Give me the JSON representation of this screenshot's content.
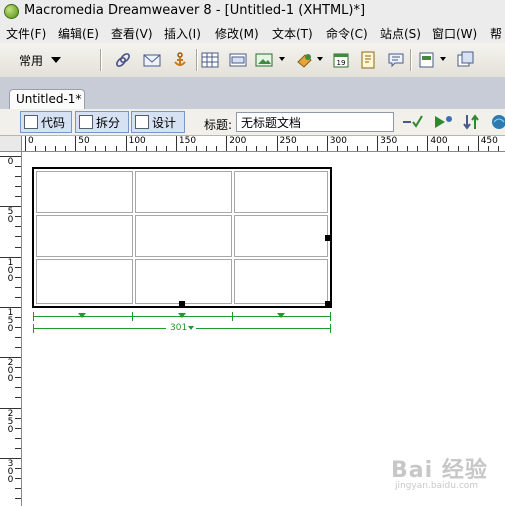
{
  "window": {
    "title": "Macromedia Dreamweaver 8 - [Untitled-1 (XHTML)*]"
  },
  "menu": [
    "文件(F)",
    "编辑(E)",
    "查看(V)",
    "插入(I)",
    "修改(M)",
    "文本(T)",
    "命令(C)",
    "站点(S)",
    "窗口(W)",
    "帮"
  ],
  "toolbar": {
    "category": "常用",
    "icons": [
      "hyperlink-icon",
      "email-link-icon",
      "named-anchor-icon",
      "table-icon",
      "div-icon",
      "image-icon",
      "media-icon",
      "date-icon",
      "comment-icon",
      "script-icon",
      "tag-chooser-icon",
      "templates-icon"
    ]
  },
  "document": {
    "tab_label": "Untitled-1*",
    "view_buttons": {
      "code": "代码",
      "split": "拆分",
      "design": "设计"
    },
    "title_label": "标题:",
    "title_value": "无标题文档"
  },
  "ruler": {
    "top_labels": [
      "0",
      "50",
      "100",
      "150",
      "200",
      "250",
      "300",
      "350",
      "400",
      "450"
    ],
    "left_labels": [
      "0",
      "50",
      "100",
      "150",
      "200",
      "250",
      "300"
    ]
  },
  "table": {
    "rows": 3,
    "columns": 3,
    "width_label": "301"
  },
  "watermark": {
    "text": "Bai 经验",
    "sub": "jingyan.baidu.com"
  },
  "colors": {
    "table_guide": "#1f9a2f",
    "pressed_button": "#d6e2f4"
  }
}
